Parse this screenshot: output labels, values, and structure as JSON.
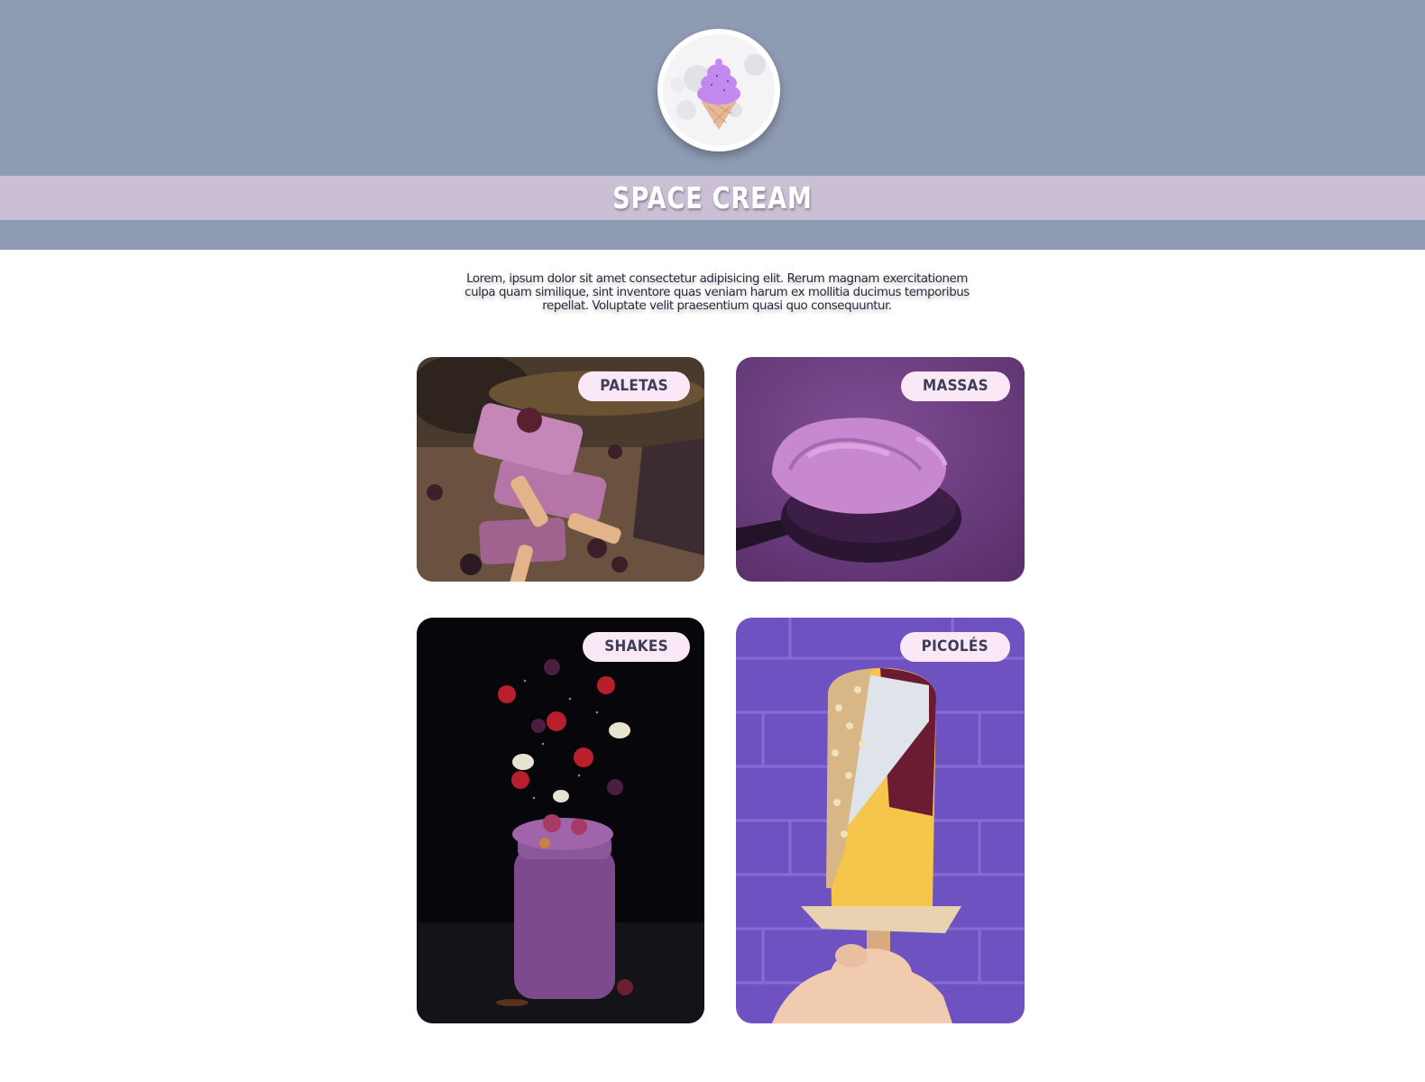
{
  "header": {
    "background_color": "#8e9bb3",
    "band_color": "#cbbfd6",
    "title": "SPACE CREAM",
    "logo": {
      "icon": "ice-cream-cone-icon"
    }
  },
  "intro": {
    "text": "Lorem, ipsum dolor sit amet consectetur adipisicing elit. Rerum magnam exercitationem culpa quam similique, sint inventore quas veniam harum ex mollitia ducimus temporibus repellat. Voluptate velit praesentium quasi quo consequuntur."
  },
  "cards": [
    {
      "label": "PALETAS",
      "image": "stacked-purple-ice-cream-bars-photo"
    },
    {
      "label": "MASSAS",
      "image": "purple-ice-cream-scoop-photo"
    },
    {
      "label": "SHAKES",
      "image": "berry-shake-jar-photo"
    },
    {
      "label": "PICOLÉS",
      "image": "popsicle-purple-wall-photo"
    }
  ],
  "tag_color": "#fbe8f6"
}
